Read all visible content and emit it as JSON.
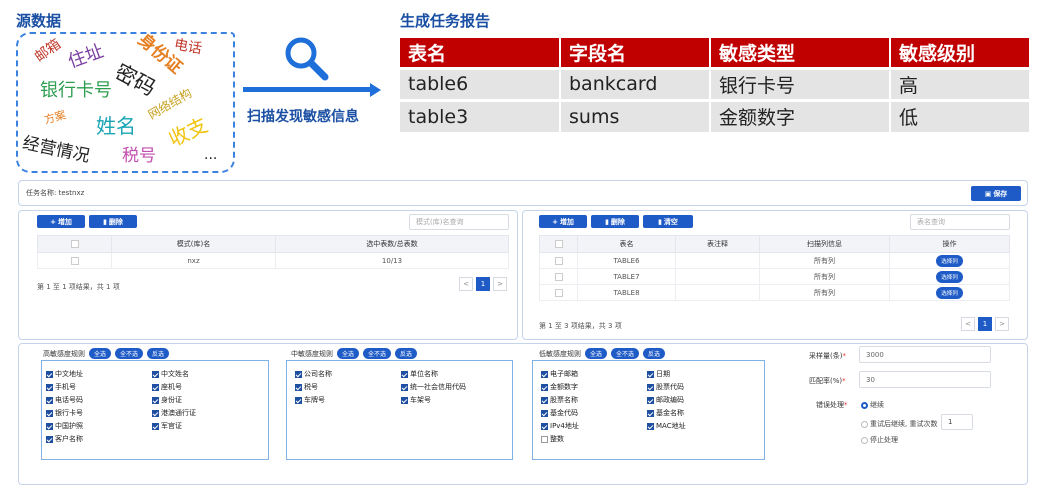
{
  "source": {
    "title": "源数据",
    "words": [
      "邮箱",
      "住址",
      "身份证",
      "电话",
      "银行卡号",
      "密码",
      "网络结构",
      "方案",
      "姓名",
      "经营情况",
      "收支",
      "税号",
      "..."
    ]
  },
  "scan_label": "扫描发现敏感信息",
  "report": {
    "title": "生成任务报告",
    "headers": [
      "表名",
      "字段名",
      "敏感类型",
      "敏感级别"
    ],
    "rows": [
      [
        "table6",
        "bankcard",
        "银行卡号",
        "高"
      ],
      [
        "table3",
        "sums",
        "金额数字",
        "低"
      ]
    ]
  },
  "colors": {
    "accent": "#1f5bc6",
    "header_red": "#c00000",
    "title_blue": "#1a4fa3"
  },
  "task": {
    "name_label": "任务名称: testnxz",
    "save_label": "保存"
  },
  "left": {
    "add": "增加",
    "del": "删除",
    "search_placeholder": "模式(库)名查询",
    "headers": [
      "",
      "模式(库)名",
      "选中表数/总表数"
    ],
    "rows": [
      [
        "",
        "nxz",
        "10/13"
      ]
    ],
    "info": "第 1 至 1 项结果，共 1 项",
    "page": "1"
  },
  "right": {
    "add": "增加",
    "del": "删除",
    "clear": "清空",
    "search_placeholder": "表名查询",
    "headers": [
      "",
      "表名",
      "表注释",
      "扫描列信息",
      "操作"
    ],
    "rows": [
      [
        "",
        "TABLE6",
        "",
        "所有列",
        "选择列"
      ],
      [
        "",
        "TABLE7",
        "",
        "所有列",
        "选择列"
      ],
      [
        "",
        "TABLE8",
        "",
        "所有列",
        "选择列"
      ]
    ],
    "info": "第 1 至 3 项结果，共 3 项",
    "page": "1"
  },
  "rules": [
    {
      "title": "高敏感度规则",
      "btns": [
        "全选",
        "全不选",
        "反选"
      ],
      "col1": [
        "中文地址",
        "手机号",
        "电话号码",
        "银行卡号",
        "中国护照",
        "客户名称"
      ],
      "col2": [
        "中文姓名",
        "座机号",
        "身份证",
        "港澳通行证",
        "军官证"
      ]
    },
    {
      "title": "中敏感度规则",
      "btns": [
        "全选",
        "全不选",
        "反选"
      ],
      "col1": [
        "公司名称",
        "税号",
        "车牌号"
      ],
      "col2": [
        "单位名称",
        "统一社会信用代码",
        "车架号"
      ]
    },
    {
      "title": "低敏感度规则",
      "btns": [
        "全选",
        "全不选",
        "反选"
      ],
      "col1": [
        "电子邮箱",
        "金额数字",
        "股票名称",
        "基金代码",
        "IPv4地址",
        "整数"
      ],
      "col2": [
        "日期",
        "股票代码",
        "邮政编码",
        "基金名称",
        "MAC地址"
      ]
    }
  ],
  "settings": {
    "sample_label": "采样量(条)",
    "sample_value": "3000",
    "match_label": "匹配率(%)",
    "match_value": "30",
    "error_label": "错误处理",
    "opt_continue": "继续",
    "opt_retry": "重试后继续, 重试次数",
    "retry_value": "1",
    "opt_stop": "停止处理"
  },
  "pagination": {
    "prev": "<",
    "next": ">"
  }
}
